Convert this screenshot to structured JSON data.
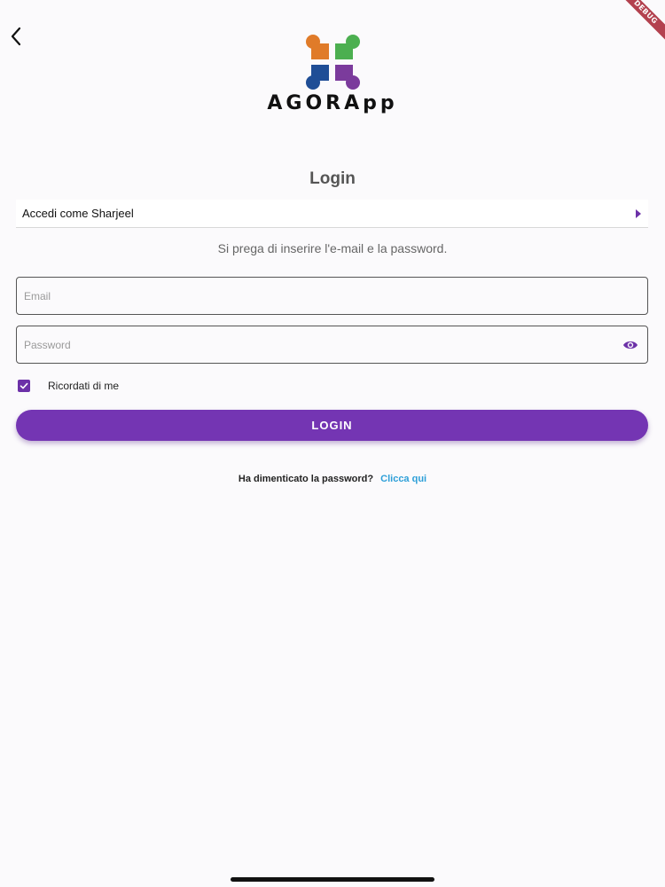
{
  "header": {
    "brand": "AGORApp",
    "debug_banner": "DEBUG"
  },
  "login": {
    "title": "Login",
    "account_option": "Accedi come Sharjeel",
    "hint": "Si prega di inserire l'e-mail e la password.",
    "email_placeholder": "Email",
    "password_placeholder": "Password",
    "remember_label": "Ricordati di me",
    "remember_checked": true,
    "button_label": "LOGIN",
    "forgot_text": "Ha dimenticato la password?",
    "forgot_link": "Clicca qui"
  },
  "icons": {
    "back": "chevron-left-icon",
    "eye": "eye-icon",
    "caret": "caret-right-icon",
    "check": "check-icon"
  },
  "colors": {
    "accent": "#7435b3",
    "link": "#2d9fd8",
    "logo_orange": "#e07b29",
    "logo_green": "#4caf50",
    "logo_blue": "#1f4e96",
    "logo_purple": "#7b3b9c"
  }
}
